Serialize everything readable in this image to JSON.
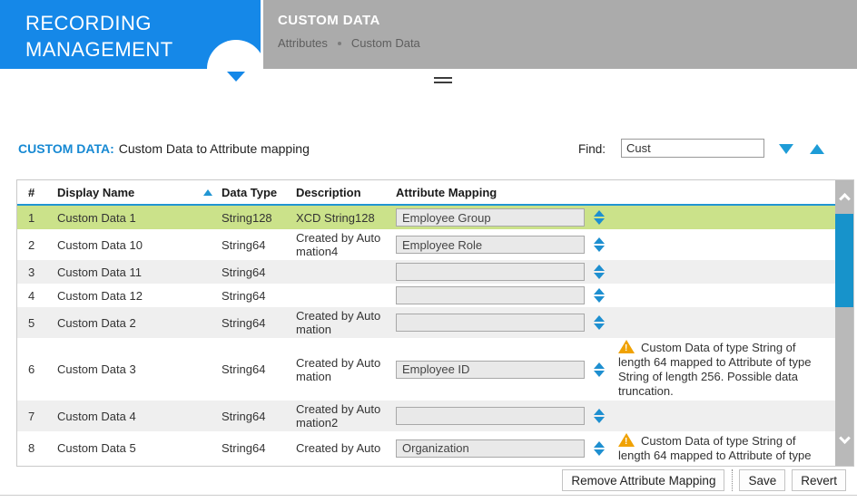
{
  "header": {
    "app_title_line1": "RECORDING",
    "app_title_line2": "MANAGEMENT",
    "page_title": "CUSTOM DATA",
    "breadcrumb_parent": "Attributes",
    "breadcrumb_current": "Custom Data"
  },
  "panel": {
    "heading_label": "CUSTOM DATA:",
    "heading_text": "Custom Data to Attribute mapping",
    "find_label": "Find:",
    "find_value": "Cust"
  },
  "table": {
    "columns": [
      "#",
      "Display Name",
      "Data Type",
      "Description",
      "Attribute Mapping"
    ],
    "rows": [
      {
        "num": "1",
        "name": "Custom Data 1",
        "type": "String128",
        "desc": "XCD String128",
        "mapping": "Employee Group",
        "warning": "",
        "selected": true
      },
      {
        "num": "2",
        "name": "Custom Data 10",
        "type": "String64",
        "desc": "Created by Auto mation4",
        "mapping": "Employee Role",
        "warning": ""
      },
      {
        "num": "3",
        "name": "Custom Data 11",
        "type": "String64",
        "desc": "",
        "mapping": "",
        "warning": ""
      },
      {
        "num": "4",
        "name": "Custom Data 12",
        "type": "String64",
        "desc": "",
        "mapping": "",
        "warning": ""
      },
      {
        "num": "5",
        "name": "Custom Data 2",
        "type": "String64",
        "desc": "Created by Auto mation",
        "mapping": "",
        "warning": ""
      },
      {
        "num": "6",
        "name": "Custom Data 3",
        "type": "String64",
        "desc": "Created by Auto mation",
        "mapping": "Employee ID",
        "warning": "Custom Data of type String of length 64 mapped to Attribute of type String of length 256. Possible data truncation."
      },
      {
        "num": "7",
        "name": "Custom Data 4",
        "type": "String64",
        "desc": "Created by Auto mation2",
        "mapping": "",
        "warning": ""
      },
      {
        "num": "8",
        "name": "Custom Data 5",
        "type": "String64",
        "desc": "Created by Auto",
        "mapping": "Organization",
        "warning": "Custom Data of type String of length 64 mapped to Attribute of type"
      }
    ]
  },
  "footer": {
    "remove_label": "Remove Attribute Mapping",
    "save_label": "Save",
    "revert_label": "Revert"
  },
  "colors": {
    "header_blue": "#1588e8",
    "header_gray": "#ababab",
    "heading_text_blue": "#1789d3",
    "accent_blue": "#1e9cd7",
    "selected_row_green": "#cbe28a",
    "alt_row_gray": "#efefef",
    "warning_orange": "#f0a202",
    "scrollbar_thumb_blue": "#1793cb"
  },
  "icons": {
    "collapse-panel-icon": "▼",
    "splitter-handle-icon": "=",
    "find-next-icon": "▼",
    "find-previous-icon": "▲",
    "sort-ascending-icon": "▲",
    "attribute-spinner-icon": "▲▼",
    "warning-icon": "⚠",
    "scroll-up-icon": "^",
    "scroll-down-icon": "v"
  }
}
